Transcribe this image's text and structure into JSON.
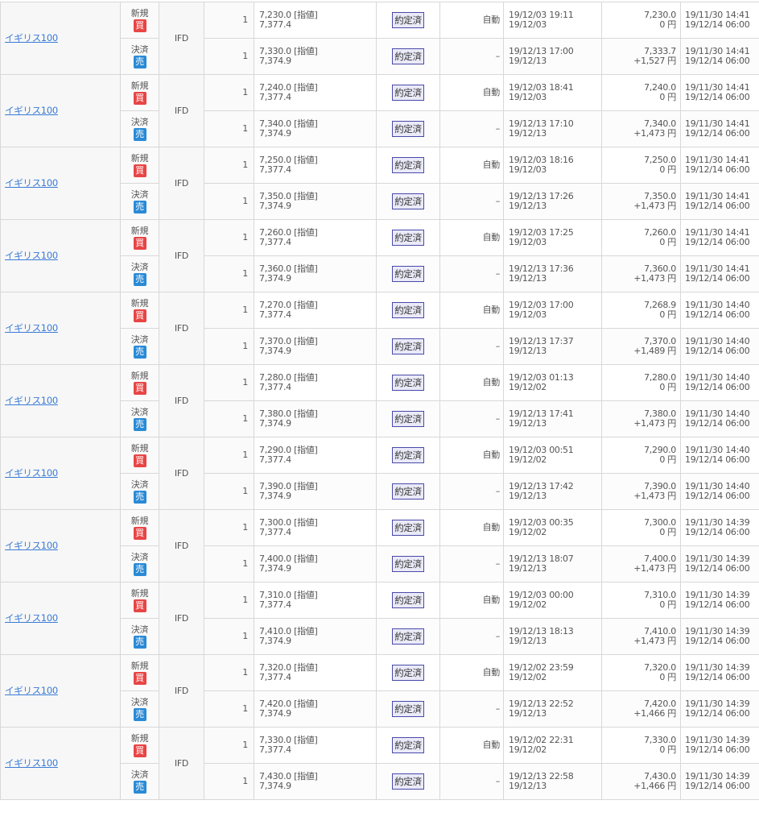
{
  "rows": [
    {
      "symbol": "イギリス100",
      "type": "IFD",
      "open": {
        "kind": "新規",
        "side": "買",
        "qty": "1",
        "price": "7,230.0 [指値]",
        "rate": "7,377.4",
        "status": "約定済",
        "exec": "自動",
        "date1": "19/12/03 19:11",
        "date2": "19/12/03",
        "amount": "7,230.0",
        "pnl": "0 円",
        "start": "19/11/30 14:41",
        "end": "19/12/14 06:00"
      },
      "close": {
        "kind": "決済",
        "side": "売",
        "qty": "1",
        "price": "7,330.0 [指値]",
        "rate": "7,374.9",
        "status": "約定済",
        "exec": "–",
        "date1": "19/12/13 17:00",
        "date2": "19/12/13",
        "amount": "7,333.7",
        "pnl": "+1,527 円",
        "start": "19/11/30 14:41",
        "end": "19/12/14 06:00"
      }
    },
    {
      "symbol": "イギリス100",
      "type": "IFD",
      "open": {
        "kind": "新規",
        "side": "買",
        "qty": "1",
        "price": "7,240.0 [指値]",
        "rate": "7,377.4",
        "status": "約定済",
        "exec": "自動",
        "date1": "19/12/03 18:41",
        "date2": "19/12/03",
        "amount": "7,240.0",
        "pnl": "0 円",
        "start": "19/11/30 14:41",
        "end": "19/12/14 06:00"
      },
      "close": {
        "kind": "決済",
        "side": "売",
        "qty": "1",
        "price": "7,340.0 [指値]",
        "rate": "7,374.9",
        "status": "約定済",
        "exec": "–",
        "date1": "19/12/13 17:10",
        "date2": "19/12/13",
        "amount": "7,340.0",
        "pnl": "+1,473 円",
        "start": "19/11/30 14:41",
        "end": "19/12/14 06:00"
      }
    },
    {
      "symbol": "イギリス100",
      "type": "IFD",
      "open": {
        "kind": "新規",
        "side": "買",
        "qty": "1",
        "price": "7,250.0 [指値]",
        "rate": "7,377.4",
        "status": "約定済",
        "exec": "自動",
        "date1": "19/12/03 18:16",
        "date2": "19/12/03",
        "amount": "7,250.0",
        "pnl": "0 円",
        "start": "19/11/30 14:41",
        "end": "19/12/14 06:00"
      },
      "close": {
        "kind": "決済",
        "side": "売",
        "qty": "1",
        "price": "7,350.0 [指値]",
        "rate": "7,374.9",
        "status": "約定済",
        "exec": "–",
        "date1": "19/12/13 17:26",
        "date2": "19/12/13",
        "amount": "7,350.0",
        "pnl": "+1,473 円",
        "start": "19/11/30 14:41",
        "end": "19/12/14 06:00"
      }
    },
    {
      "symbol": "イギリス100",
      "type": "IFD",
      "open": {
        "kind": "新規",
        "side": "買",
        "qty": "1",
        "price": "7,260.0 [指値]",
        "rate": "7,377.4",
        "status": "約定済",
        "exec": "自動",
        "date1": "19/12/03 17:25",
        "date2": "19/12/03",
        "amount": "7,260.0",
        "pnl": "0 円",
        "start": "19/11/30 14:41",
        "end": "19/12/14 06:00"
      },
      "close": {
        "kind": "決済",
        "side": "売",
        "qty": "1",
        "price": "7,360.0 [指値]",
        "rate": "7,374.9",
        "status": "約定済",
        "exec": "–",
        "date1": "19/12/13 17:36",
        "date2": "19/12/13",
        "amount": "7,360.0",
        "pnl": "+1,473 円",
        "start": "19/11/30 14:41",
        "end": "19/12/14 06:00"
      }
    },
    {
      "symbol": "イギリス100",
      "type": "IFD",
      "open": {
        "kind": "新規",
        "side": "買",
        "qty": "1",
        "price": "7,270.0 [指値]",
        "rate": "7,377.4",
        "status": "約定済",
        "exec": "自動",
        "date1": "19/12/03 17:00",
        "date2": "19/12/03",
        "amount": "7,268.9",
        "pnl": "0 円",
        "start": "19/11/30 14:40",
        "end": "19/12/14 06:00"
      },
      "close": {
        "kind": "決済",
        "side": "売",
        "qty": "1",
        "price": "7,370.0 [指値]",
        "rate": "7,374.9",
        "status": "約定済",
        "exec": "–",
        "date1": "19/12/13 17:37",
        "date2": "19/12/13",
        "amount": "7,370.0",
        "pnl": "+1,489 円",
        "start": "19/11/30 14:40",
        "end": "19/12/14 06:00"
      }
    },
    {
      "symbol": "イギリス100",
      "type": "IFD",
      "open": {
        "kind": "新規",
        "side": "買",
        "qty": "1",
        "price": "7,280.0 [指値]",
        "rate": "7,377.4",
        "status": "約定済",
        "exec": "自動",
        "date1": "19/12/03 01:13",
        "date2": "19/12/02",
        "amount": "7,280.0",
        "pnl": "0 円",
        "start": "19/11/30 14:40",
        "end": "19/12/14 06:00"
      },
      "close": {
        "kind": "決済",
        "side": "売",
        "qty": "1",
        "price": "7,380.0 [指値]",
        "rate": "7,374.9",
        "status": "約定済",
        "exec": "–",
        "date1": "19/12/13 17:41",
        "date2": "19/12/13",
        "amount": "7,380.0",
        "pnl": "+1,473 円",
        "start": "19/11/30 14:40",
        "end": "19/12/14 06:00"
      }
    },
    {
      "symbol": "イギリス100",
      "type": "IFD",
      "open": {
        "kind": "新規",
        "side": "買",
        "qty": "1",
        "price": "7,290.0 [指値]",
        "rate": "7,377.4",
        "status": "約定済",
        "exec": "自動",
        "date1": "19/12/03 00:51",
        "date2": "19/12/02",
        "amount": "7,290.0",
        "pnl": "0 円",
        "start": "19/11/30 14:40",
        "end": "19/12/14 06:00"
      },
      "close": {
        "kind": "決済",
        "side": "売",
        "qty": "1",
        "price": "7,390.0 [指値]",
        "rate": "7,374.9",
        "status": "約定済",
        "exec": "–",
        "date1": "19/12/13 17:42",
        "date2": "19/12/13",
        "amount": "7,390.0",
        "pnl": "+1,473 円",
        "start": "19/11/30 14:40",
        "end": "19/12/14 06:00"
      }
    },
    {
      "symbol": "イギリス100",
      "type": "IFD",
      "open": {
        "kind": "新規",
        "side": "買",
        "qty": "1",
        "price": "7,300.0 [指値]",
        "rate": "7,377.4",
        "status": "約定済",
        "exec": "自動",
        "date1": "19/12/03 00:35",
        "date2": "19/12/02",
        "amount": "7,300.0",
        "pnl": "0 円",
        "start": "19/11/30 14:39",
        "end": "19/12/14 06:00"
      },
      "close": {
        "kind": "決済",
        "side": "売",
        "qty": "1",
        "price": "7,400.0 [指値]",
        "rate": "7,374.9",
        "status": "約定済",
        "exec": "–",
        "date1": "19/12/13 18:07",
        "date2": "19/12/13",
        "amount": "7,400.0",
        "pnl": "+1,473 円",
        "start": "19/11/30 14:39",
        "end": "19/12/14 06:00"
      }
    },
    {
      "symbol": "イギリス100",
      "type": "IFD",
      "open": {
        "kind": "新規",
        "side": "買",
        "qty": "1",
        "price": "7,310.0 [指値]",
        "rate": "7,377.4",
        "status": "約定済",
        "exec": "自動",
        "date1": "19/12/03 00:00",
        "date2": "19/12/02",
        "amount": "7,310.0",
        "pnl": "0 円",
        "start": "19/11/30 14:39",
        "end": "19/12/14 06:00"
      },
      "close": {
        "kind": "決済",
        "side": "売",
        "qty": "1",
        "price": "7,410.0 [指値]",
        "rate": "7,374.9",
        "status": "約定済",
        "exec": "–",
        "date1": "19/12/13 18:13",
        "date2": "19/12/13",
        "amount": "7,410.0",
        "pnl": "+1,473 円",
        "start": "19/11/30 14:39",
        "end": "19/12/14 06:00"
      }
    },
    {
      "symbol": "イギリス100",
      "type": "IFD",
      "open": {
        "kind": "新規",
        "side": "買",
        "qty": "1",
        "price": "7,320.0 [指値]",
        "rate": "7,377.4",
        "status": "約定済",
        "exec": "自動",
        "date1": "19/12/02 23:59",
        "date2": "19/12/02",
        "amount": "7,320.0",
        "pnl": "0 円",
        "start": "19/11/30 14:39",
        "end": "19/12/14 06:00"
      },
      "close": {
        "kind": "決済",
        "side": "売",
        "qty": "1",
        "price": "7,420.0 [指値]",
        "rate": "7,374.9",
        "status": "約定済",
        "exec": "–",
        "date1": "19/12/13 22:52",
        "date2": "19/12/13",
        "amount": "7,420.0",
        "pnl": "+1,466 円",
        "start": "19/11/30 14:39",
        "end": "19/12/14 06:00"
      }
    },
    {
      "symbol": "イギリス100",
      "type": "IFD",
      "open": {
        "kind": "新規",
        "side": "買",
        "qty": "1",
        "price": "7,330.0 [指値]",
        "rate": "7,377.4",
        "status": "約定済",
        "exec": "自動",
        "date1": "19/12/02 22:31",
        "date2": "19/12/02",
        "amount": "7,330.0",
        "pnl": "0 円",
        "start": "19/11/30 14:39",
        "end": "19/12/14 06:00"
      },
      "close": {
        "kind": "決済",
        "side": "売",
        "qty": "1",
        "price": "7,430.0 [指値]",
        "rate": "7,374.9",
        "status": "約定済",
        "exec": "–",
        "date1": "19/12/13 22:58",
        "date2": "19/12/13",
        "amount": "7,430.0",
        "pnl": "+1,466 円",
        "start": "19/11/30 14:39",
        "end": "19/12/14 06:00"
      }
    }
  ],
  "colors": {
    "buy_badge": "#e84545",
    "sell_badge": "#2a8ad6",
    "link": "#3a7bd5",
    "status_border": "#4a4aa8"
  }
}
